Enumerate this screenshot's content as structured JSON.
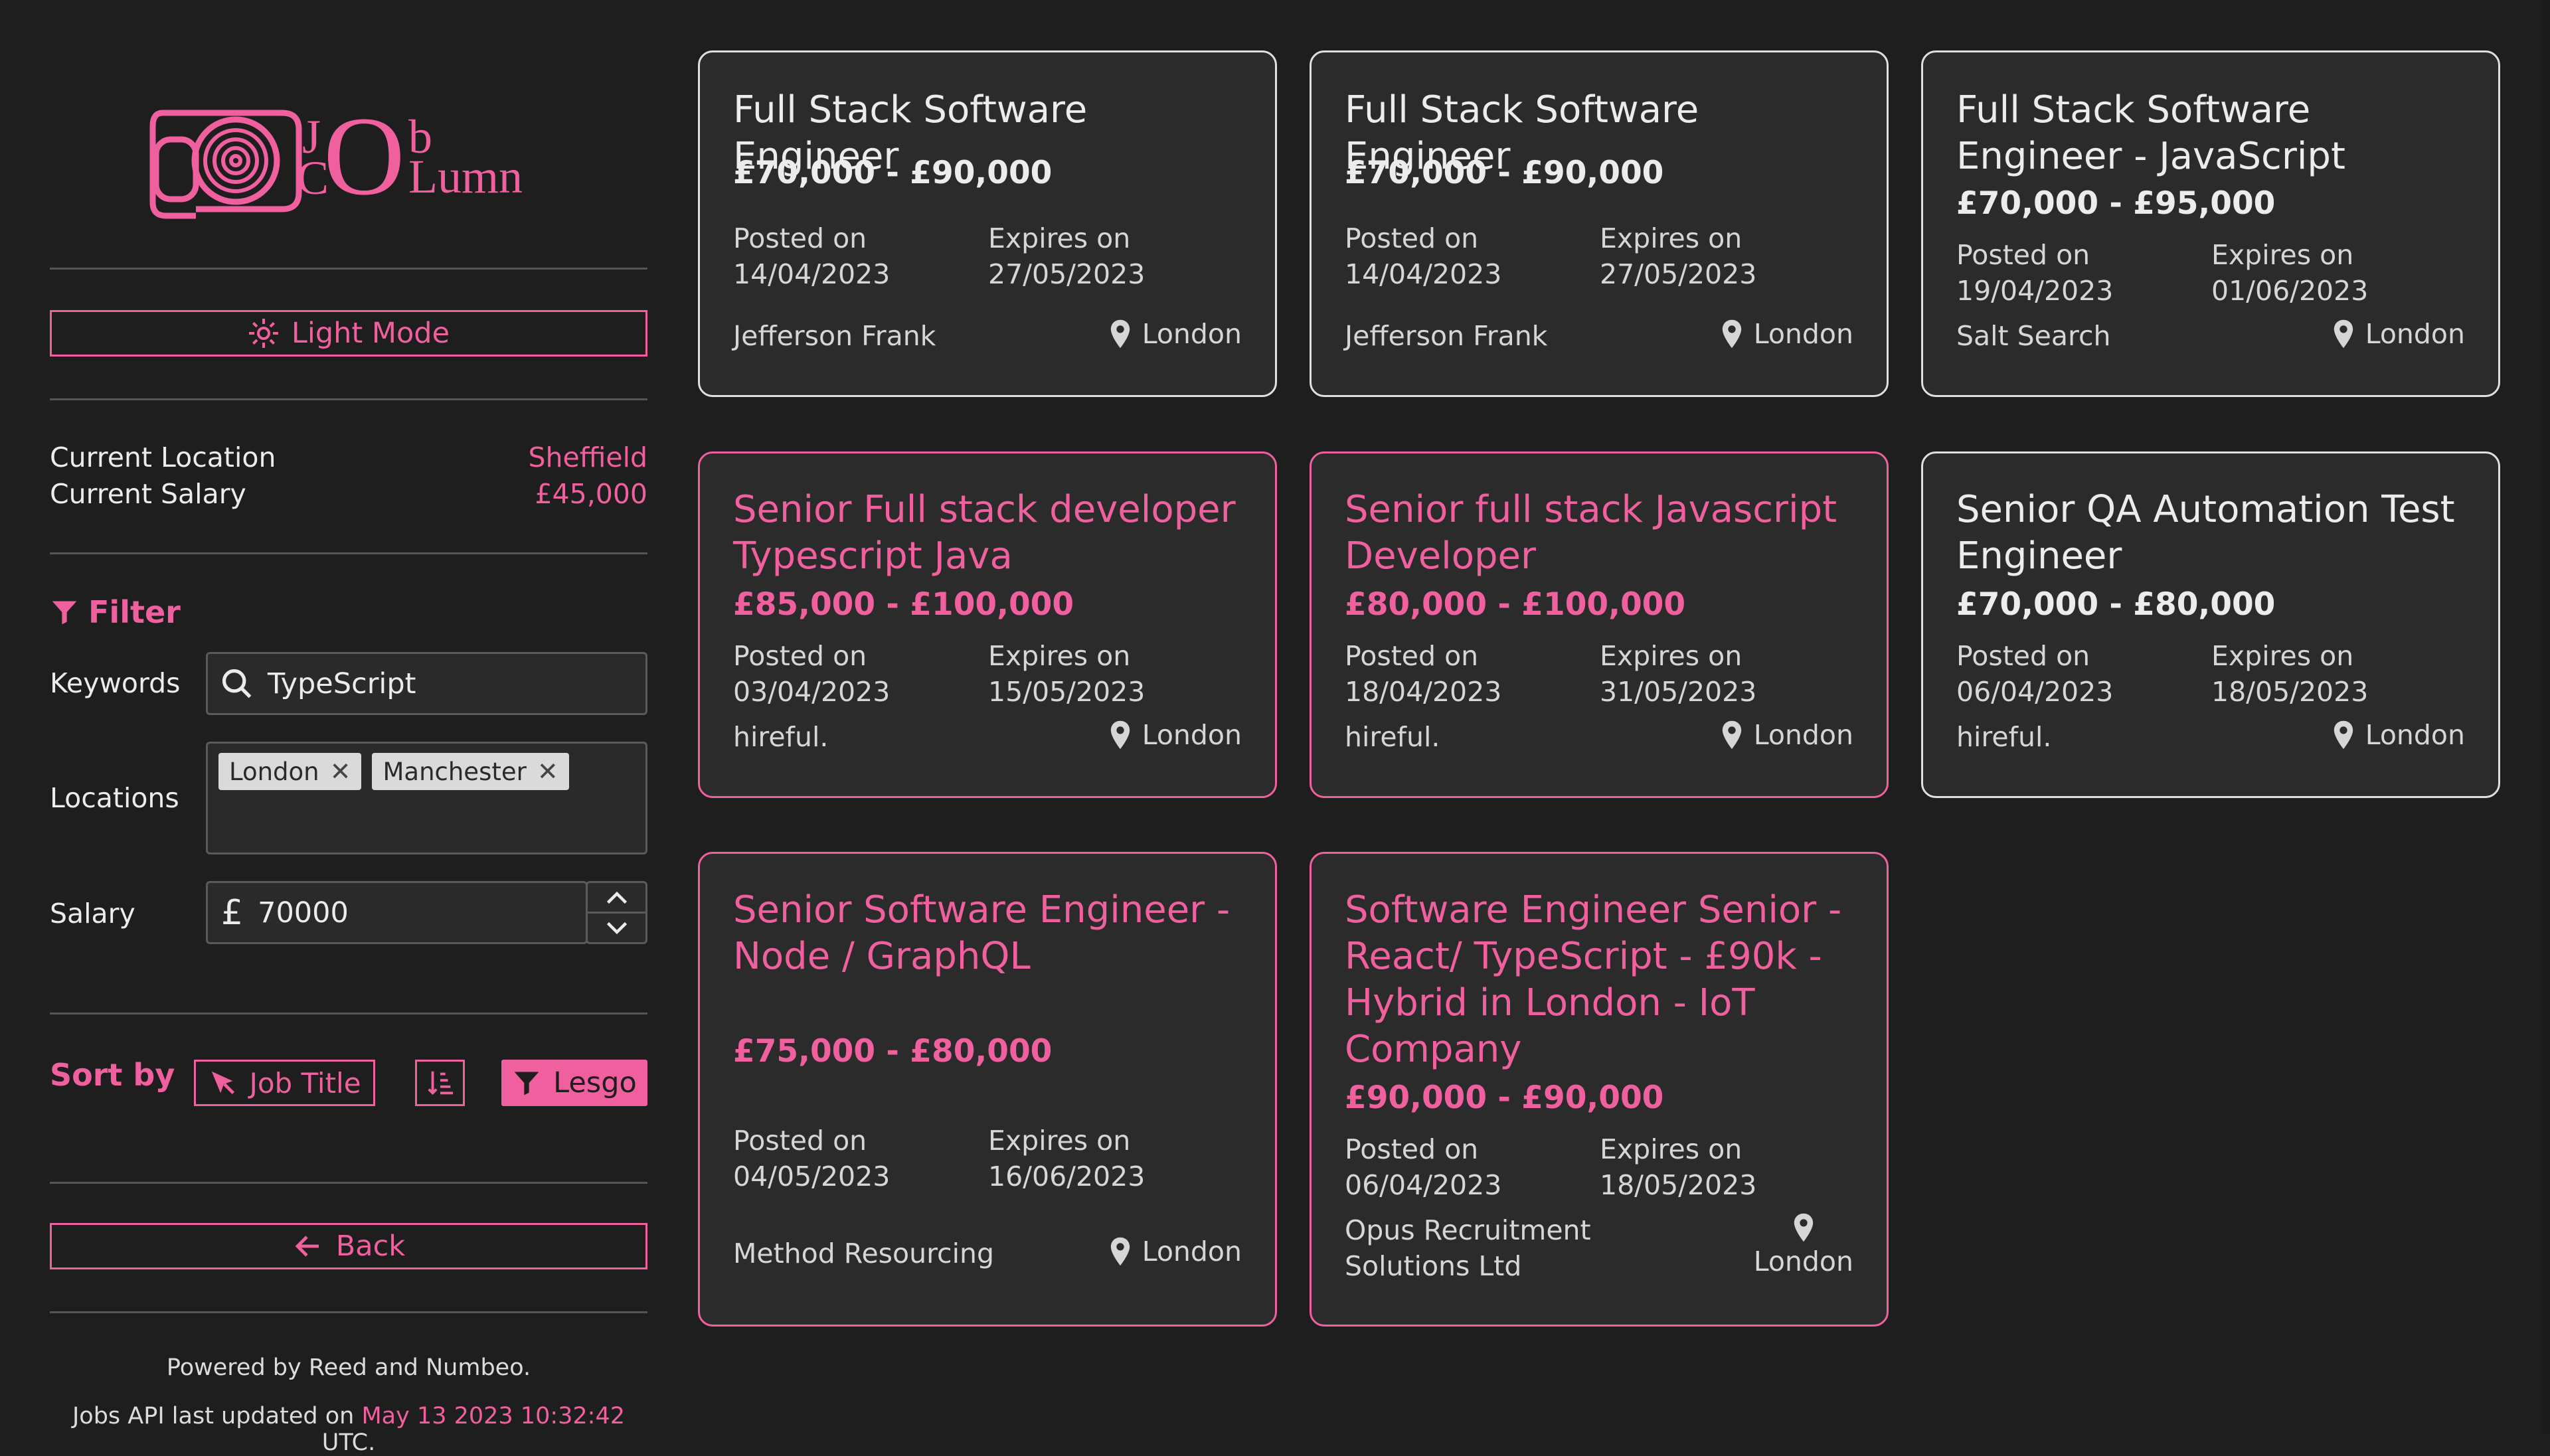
{
  "colors": {
    "accent": "#f0609e",
    "background": "#1e1e1e",
    "card": "#2b2b2b"
  },
  "sidebar": {
    "logo": {
      "word_top": "J  b",
      "word_bottom": "C O Lumn",
      "icon": "scroll-spiral-icon"
    },
    "light_mode": {
      "label": "Light Mode",
      "icon": "sun-icon"
    },
    "current": [
      {
        "label": "Current Location",
        "value": "Sheffield"
      },
      {
        "label": "Current Salary",
        "value": "£45,000"
      }
    ],
    "filter": {
      "title": "Filter",
      "keywords_label": "Keywords",
      "keywords_value": "TypeScript",
      "locations_label": "Locations",
      "locations": [
        "London",
        "Manchester"
      ],
      "salary_label": "Salary",
      "salary_symbol": "£",
      "salary_value": "70000"
    },
    "sort": {
      "label": "Sort by",
      "field": "Job Title",
      "go": "Lesgo"
    },
    "back": "Back",
    "footer": {
      "powered": "Powered by Reed and Numbeo.",
      "updated_prefix": "Jobs API last updated on",
      "updated_time": "May 13 2023 10:32:42",
      "updated_suffix": "UTC."
    }
  },
  "jobs": [
    {
      "title": "Full Stack Software Engineer",
      "salary": "£70,000 - £90,000",
      "posted_label": "Posted on",
      "posted": "14/04/2023",
      "expires_label": "Expires on",
      "expires": "27/05/2023",
      "company": "Jefferson Frank",
      "location": "London"
    },
    {
      "title": "Full Stack Software Engineer",
      "salary": "£70,000 - £90,000",
      "posted_label": "Posted on",
      "posted": "14/04/2023",
      "expires_label": "Expires on",
      "expires": "27/05/2023",
      "company": "Jefferson Frank",
      "location": "London"
    },
    {
      "title": "Full Stack Software Engineer - JavaScript",
      "salary": "£70,000 - £95,000",
      "posted_label": "Posted on",
      "posted": "19/04/2023",
      "expires_label": "Expires on",
      "expires": "01/06/2023",
      "company": "Salt Search",
      "location": "London"
    },
    {
      "title": "Senior Full stack developer Typescript Java",
      "salary": "£85,000 - £100,000",
      "posted_label": "Posted on",
      "posted": "03/04/2023",
      "expires_label": "Expires on",
      "expires": "15/05/2023",
      "company": "hireful.",
      "location": "London"
    },
    {
      "title": "Senior full stack Javascript Developer",
      "salary": "£80,000 - £100,000",
      "posted_label": "Posted on",
      "posted": "18/04/2023",
      "expires_label": "Expires on",
      "expires": "31/05/2023",
      "company": "hireful.",
      "location": "London"
    },
    {
      "title": "Senior QA Automation Test Engineer",
      "salary": "£70,000 - £80,000",
      "posted_label": "Posted on",
      "posted": "06/04/2023",
      "expires_label": "Expires on",
      "expires": "18/05/2023",
      "company": "hireful.",
      "location": "London"
    },
    {
      "title": "Senior Software Engineer - Node / GraphQL",
      "salary": "£75,000 - £80,000",
      "posted_label": "Posted on",
      "posted": "04/05/2023",
      "expires_label": "Expires on",
      "expires": "16/06/2023",
      "company": "Method Resourcing",
      "location": "London"
    },
    {
      "title": "Software Engineer Senior - React/ TypeScript - £90k - Hybrid in London - IoT Company",
      "salary": "£90,000 - £90,000",
      "posted_label": "Posted on",
      "posted": "06/04/2023",
      "expires_label": "Expires on",
      "expires": "18/05/2023",
      "company": "Opus Recruitment Solutions Ltd",
      "location": "London"
    }
  ]
}
